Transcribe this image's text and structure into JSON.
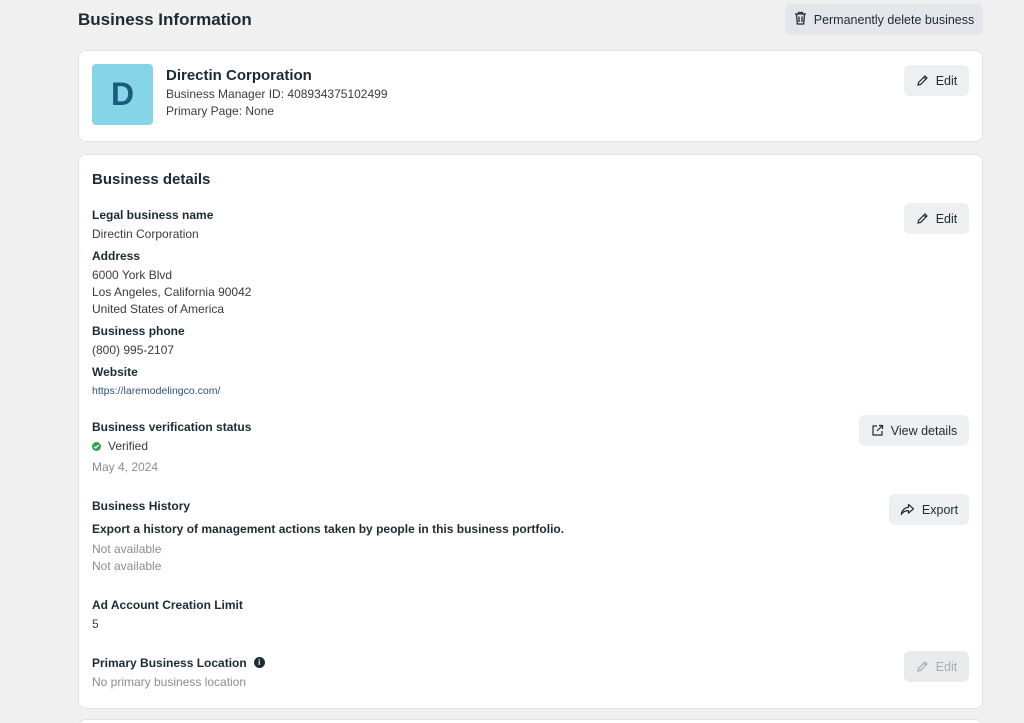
{
  "header": {
    "title": "Business Information",
    "delete_label": "Permanently delete business"
  },
  "profile": {
    "avatar_letter": "D",
    "name": "Directin Corporation",
    "manager_id": "Business Manager ID: 408934375102499",
    "primary_page": "Primary Page: None",
    "edit_label": "Edit"
  },
  "details": {
    "title": "Business details",
    "edit_label": "Edit",
    "legal_name_label": "Legal business name",
    "legal_name": "Directin Corporation",
    "address_label": "Address",
    "address_line1": "6000 York Blvd",
    "address_line2": "Los Angeles, California 90042",
    "address_line3": "United States of America",
    "phone_label": "Business phone",
    "phone": "(800) 995-2107",
    "website_label": "Website",
    "website": "https://laremodelingco.com/",
    "verification_label": "Business verification status",
    "verification_status": "Verified",
    "verification_date": "May 4, 2024",
    "view_details_label": "View details",
    "history_label": "Business History",
    "history_desc": "Export a history of management actions taken by people in this business portfolio.",
    "history_value1": "Not available",
    "history_value2": "Not available",
    "export_label": "Export",
    "ad_limit_label": "Ad Account Creation Limit",
    "ad_limit": "5",
    "location_label": "Primary Business Location",
    "location_value": "No primary business location",
    "location_edit_label": "Edit"
  },
  "colors": {
    "avatar_bg": "#86d5e7",
    "verified": "#31a24c"
  }
}
